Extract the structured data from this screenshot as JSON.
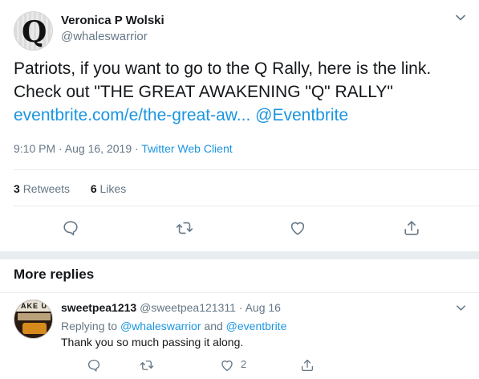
{
  "tweet": {
    "author_name": "Veronica P Wolski",
    "author_handle": "@whaleswarrior",
    "avatar_letter": "Q",
    "text_part1": "Patriots, if you want to go to the Q Rally, here is the link. Check out \"THE GREAT AWAKENING \"Q\" RALLY\"",
    "link_1": "eventbrite.com/e/the-great-aw...",
    "link_2": "@Eventbrite",
    "time": "9:10 PM · Aug 16, 2019 ·",
    "client": "Twitter Web Client",
    "retweets_count": "3",
    "retweets_label": "Retweets",
    "likes_count": "6",
    "likes_label": "Likes"
  },
  "more_replies": {
    "title": "More replies"
  },
  "reply": {
    "avatar_text": "AKE U",
    "author_name": "sweetpea1213",
    "author_handle": "@sweetpea121311 · Aug 16",
    "replying_prefix": "Replying to",
    "replying_to_1": "@whaleswarrior",
    "replying_and": "and",
    "replying_to_2": "@eventbrite",
    "text": "Thank you so much passing it along.",
    "like_count": "2"
  },
  "colors": {
    "accent": "#1b95e0",
    "muted": "#657786",
    "text": "#14171a",
    "border": "#e6ecf0"
  },
  "icons": [
    "chevron-down-icon",
    "reply-icon",
    "retweet-icon",
    "like-icon",
    "share-icon"
  ]
}
